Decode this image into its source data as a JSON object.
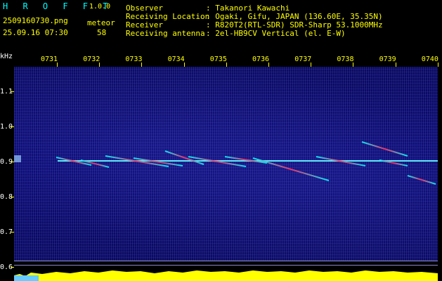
{
  "header": {
    "app_name": "H R O F F T",
    "version": "1.0.0",
    "filename": "2509160730.png",
    "datetime": "25.09.16 07:30",
    "meteor_label": "meteor",
    "meteor_count": "58",
    "labels": {
      "observer": "Observer",
      "location": "Receiving Location",
      "receiver": "Receiver",
      "antenna": "Receiving antenna"
    },
    "values": {
      "observer": ": Takanori Kawachi",
      "location": ": Ogaki, Gifu, JAPAN (136.60E, 35.35N)",
      "receiver": ": R820T2(RTL-SDR) SDR-Sharp 53.1000MHz",
      "antenna": ": 2el-HB9CV Vertical (el. E-W)"
    }
  },
  "axes": {
    "y_unit": "kHz",
    "y_ticks": [
      "1.1",
      "1.0",
      "0.9",
      "0.8",
      "0.7",
      "0.6"
    ],
    "x_ticks": [
      "0731",
      "0732",
      "0733",
      "0734",
      "0735",
      "0736",
      "0737",
      "0738",
      "0739",
      "0740"
    ]
  },
  "colors": {
    "label_yellow": "#ffff00",
    "value_cyan": "#00ffff",
    "spectrogram_bg": "#0a0a66",
    "carrier_line": "#66ffff",
    "meteor_trail": "#ff3366"
  }
}
